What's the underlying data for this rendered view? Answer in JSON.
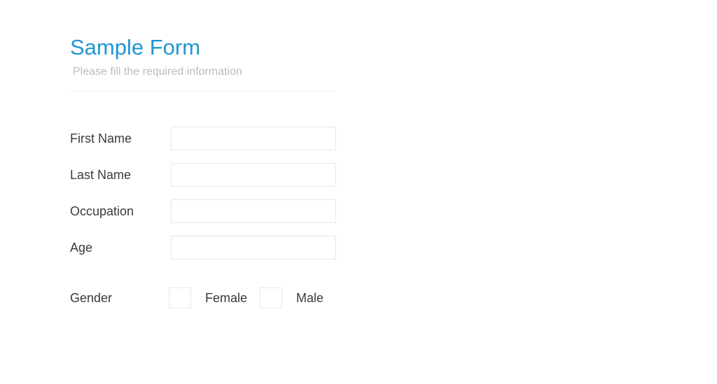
{
  "form": {
    "title": "Sample Form",
    "subtitle": "Please fill the required information",
    "fields": {
      "first_name": {
        "label": "First Name",
        "value": ""
      },
      "last_name": {
        "label": "Last Name",
        "value": ""
      },
      "occupation": {
        "label": "Occupation",
        "value": ""
      },
      "age": {
        "label": "Age",
        "value": ""
      }
    },
    "gender": {
      "label": "Gender",
      "options": [
        {
          "label": "Female"
        },
        {
          "label": "Male"
        }
      ]
    }
  }
}
